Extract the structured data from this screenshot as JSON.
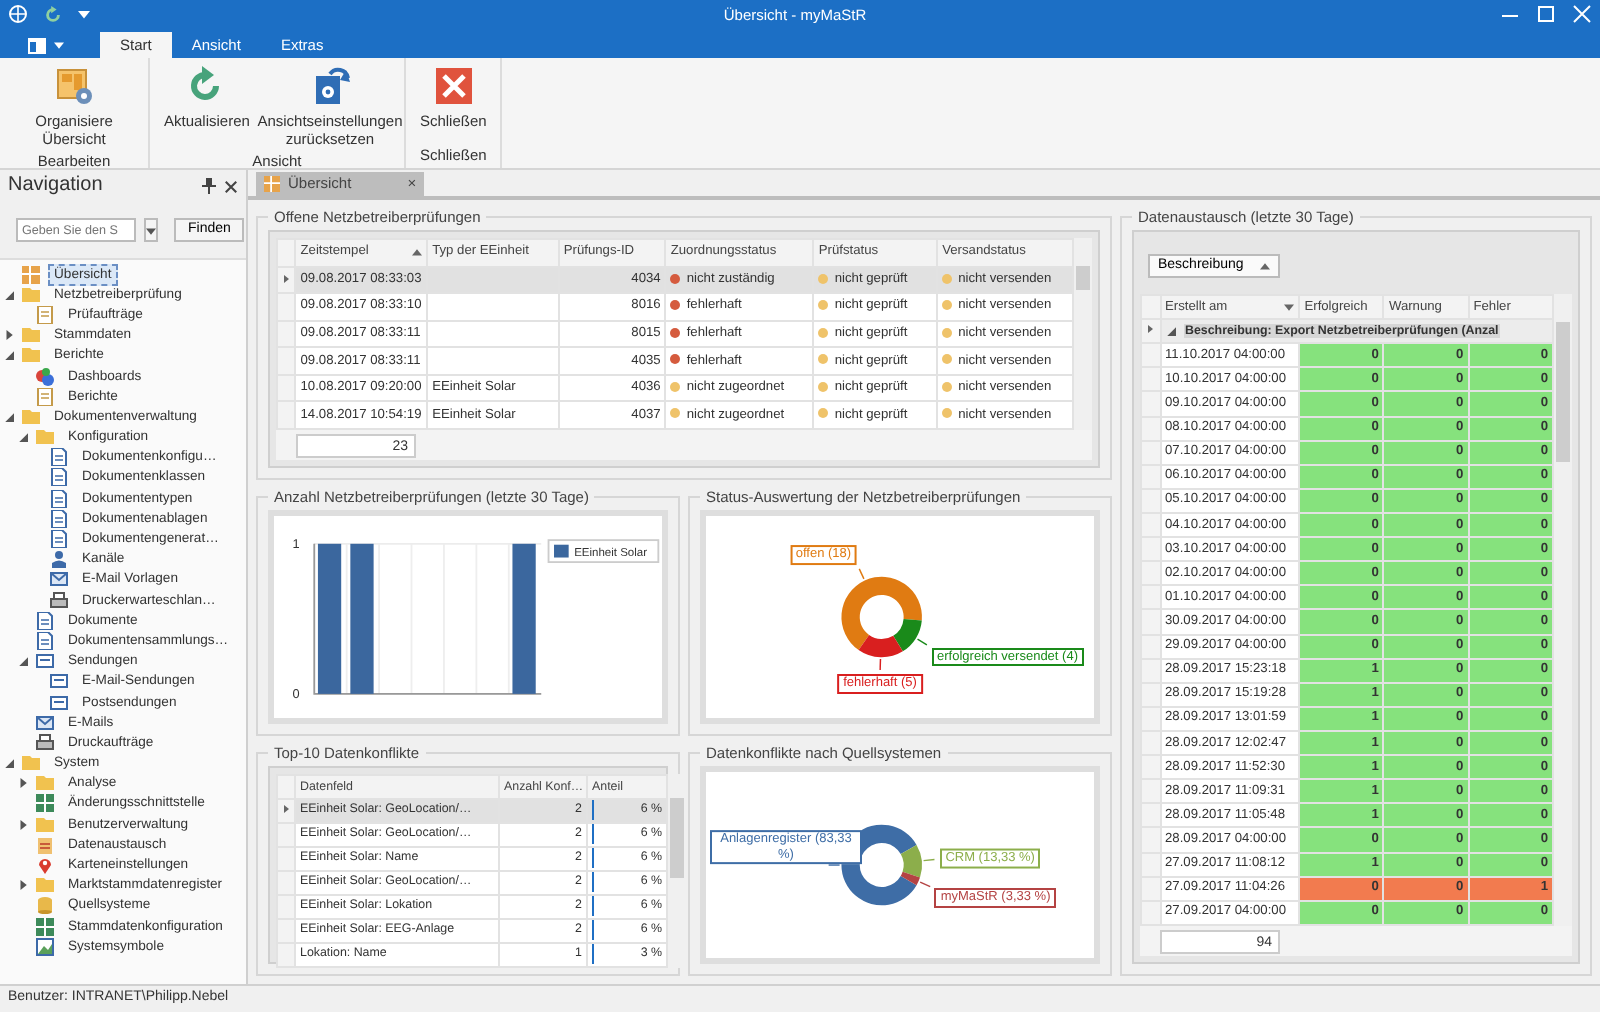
{
  "window": {
    "title": "Übersicht - myMaStR"
  },
  "ribbon": {
    "tabs": [
      {
        "label": "Start",
        "selected": true
      },
      {
        "label": "Ansicht",
        "selected": false
      },
      {
        "label": "Extras",
        "selected": false
      }
    ],
    "groups": [
      {
        "label": "Bearbeiten",
        "buttons": [
          {
            "label": "Organisiere Übersicht",
            "kind": "organize"
          }
        ]
      },
      {
        "label": "Ansicht",
        "buttons": [
          {
            "label": "Aktualisieren",
            "kind": "refresh"
          },
          {
            "label": "Ansichtseinstellungen zurücksetzen",
            "kind": "reset"
          }
        ]
      },
      {
        "label": "Schließen",
        "buttons": [
          {
            "label": "Schließen",
            "kind": "close"
          }
        ]
      }
    ]
  },
  "navigation": {
    "title": "Navigation",
    "search": {
      "placeholder": "Geben Sie den S"
    },
    "find_button": "Finden",
    "tree": [
      {
        "label": "Übersicht",
        "kind": "overview",
        "selected": true
      },
      {
        "label": "Netzbetreiberprüfung",
        "kind": "folder",
        "selected": false,
        "expanded": true,
        "children": [
          {
            "label": "Prüfaufträge",
            "kind": "page",
            "selected": false
          }
        ]
      },
      {
        "label": "Stammdaten",
        "kind": "folder",
        "selected": false,
        "expanded": false
      },
      {
        "label": "Berichte",
        "kind": "folder",
        "selected": false,
        "expanded": true,
        "children": [
          {
            "label": "Dashboards",
            "kind": "dashboard",
            "selected": false
          },
          {
            "label": "Berichte",
            "kind": "page",
            "selected": false
          }
        ]
      },
      {
        "label": "Dokumentenverwaltung",
        "kind": "folder",
        "selected": false,
        "expanded": true,
        "children": [
          {
            "label": "Konfiguration",
            "kind": "folder",
            "selected": false,
            "expanded": true,
            "children": [
              {
                "label": "Dokumentenkonfigu…",
                "kind": "doc",
                "selected": false
              },
              {
                "label": "Dokumentenklassen",
                "kind": "doc",
                "selected": false
              },
              {
                "label": "Dokumententypen",
                "kind": "doc",
                "selected": false
              },
              {
                "label": "Dokumentenablagen",
                "kind": "doc",
                "selected": false
              },
              {
                "label": "Dokumentengenerat…",
                "kind": "doc",
                "selected": false
              },
              {
                "label": "Kanäle",
                "kind": "person",
                "selected": false
              },
              {
                "label": "E-Mail Vorlagen",
                "kind": "mail",
                "selected": false
              },
              {
                "label": "Druckerwarteschlan…",
                "kind": "printer",
                "selected": false
              }
            ]
          },
          {
            "label": "Dokumente",
            "kind": "doc",
            "selected": false
          },
          {
            "label": "Dokumentensammlungs…",
            "kind": "doc",
            "selected": false
          },
          {
            "label": "Sendungen",
            "kind": "envelope",
            "selected": false,
            "expanded": true,
            "children": [
              {
                "label": "E-Mail-Sendungen",
                "kind": "envelope",
                "selected": false
              },
              {
                "label": "Postsendungen",
                "kind": "envelope",
                "selected": false
              }
            ]
          },
          {
            "label": "E-Mails",
            "kind": "mail",
            "selected": false
          },
          {
            "label": "Druckaufträge",
            "kind": "printer",
            "selected": false
          }
        ]
      },
      {
        "label": "System",
        "kind": "folder",
        "selected": false,
        "expanded": true,
        "children": [
          {
            "label": "Analyse",
            "kind": "folder",
            "selected": false,
            "expanded": false
          },
          {
            "label": "Änderungsschnittstelle",
            "kind": "grid",
            "selected": false
          },
          {
            "label": "Benutzerverwaltung",
            "kind": "folder",
            "selected": false,
            "expanded": false
          },
          {
            "label": "Datenaustausch",
            "kind": "exchange",
            "selected": false
          },
          {
            "label": "Karteneinstellungen",
            "kind": "marker",
            "selected": false
          },
          {
            "label": "Marktstammdatenregister",
            "kind": "folder",
            "selected": false,
            "expanded": false
          },
          {
            "label": "Quellsysteme",
            "kind": "database",
            "selected": false
          },
          {
            "label": "Stammdatenkonfiguration",
            "kind": "grid",
            "selected": false
          },
          {
            "label": "Systemsymbole",
            "kind": "image",
            "selected": false
          }
        ]
      }
    ]
  },
  "document_tab": {
    "label": "Übersicht",
    "close": "×",
    "selected": true
  },
  "open_checks": {
    "title": "Offene Netzbetreiberprüfungen",
    "columns": [
      {
        "label": "Zeitstempel",
        "sorted_ascending": true
      },
      {
        "label": "Typ der EEinheit"
      },
      {
        "label": "Prüfungs-ID"
      },
      {
        "label": "Zuordnungsstatus"
      },
      {
        "label": "Prüfstatus"
      },
      {
        "label": "Versandstatus"
      }
    ],
    "rows": [
      {
        "selected": true,
        "timestamp": "09.08.2017 08:33:03",
        "type": "",
        "id": "4034",
        "statuses": [
          {
            "text": "nicht zuständig",
            "color": "#d55b3e"
          },
          {
            "text": "nicht geprüft",
            "color": "#efc36a"
          },
          {
            "text": "nicht versenden",
            "color": "#efc36a"
          }
        ]
      },
      {
        "selected": false,
        "timestamp": "09.08.2017 08:33:10",
        "type": "",
        "id": "8016",
        "statuses": [
          {
            "text": "fehlerhaft",
            "color": "#d55b3e"
          },
          {
            "text": "nicht geprüft",
            "color": "#efc36a"
          },
          {
            "text": "nicht versenden",
            "color": "#efc36a"
          }
        ]
      },
      {
        "selected": false,
        "timestamp": "09.08.2017 08:33:11",
        "type": "",
        "id": "8015",
        "statuses": [
          {
            "text": "fehlerhaft",
            "color": "#d55b3e"
          },
          {
            "text": "nicht geprüft",
            "color": "#efc36a"
          },
          {
            "text": "nicht versenden",
            "color": "#efc36a"
          }
        ]
      },
      {
        "selected": false,
        "timestamp": "09.08.2017 08:33:11",
        "type": "",
        "id": "4035",
        "statuses": [
          {
            "text": "fehlerhaft",
            "color": "#d55b3e"
          },
          {
            "text": "nicht geprüft",
            "color": "#efc36a"
          },
          {
            "text": "nicht versenden",
            "color": "#efc36a"
          }
        ]
      },
      {
        "selected": false,
        "timestamp": "10.08.2017 09:20:00",
        "type": "EEinheit Solar",
        "id": "4036",
        "statuses": [
          {
            "text": "nicht zugeordnet",
            "color": "#efc36a"
          },
          {
            "text": "nicht geprüft",
            "color": "#efc36a"
          },
          {
            "text": "nicht versenden",
            "color": "#efc36a"
          }
        ]
      },
      {
        "selected": false,
        "timestamp": "14.08.2017 10:54:19",
        "type": "EEinheit Solar",
        "id": "4037",
        "statuses": [
          {
            "text": "nicht zugeordnet",
            "color": "#efc36a"
          },
          {
            "text": "nicht geprüft",
            "color": "#efc36a"
          },
          {
            "text": "nicht versenden",
            "color": "#efc36a"
          }
        ]
      }
    ],
    "count": "23"
  },
  "checks_chart": {
    "title": "Anzahl Netzbetreiberprüfungen (letzte 30 Tage)",
    "chart_data": {
      "type": "bar",
      "yticks": [
        0,
        1
      ],
      "ylim": [
        0,
        1
      ],
      "series": [
        {
          "name": "EEinheit Solar",
          "color": "#3b679e",
          "values": [
            1,
            1,
            0,
            0,
            0,
            0,
            1
          ]
        }
      ]
    }
  },
  "status_chart": {
    "title": "Status-Auswertung der Netzbetreiberprüfungen",
    "chart_data": {
      "type": "donut",
      "values": [
        18,
        4,
        5
      ],
      "colors": [
        "#e07b12",
        "#1a8a1a",
        "#d91f1f"
      ],
      "value_labels": [
        "offen (18)",
        "erfolgreich versendet (4)",
        "fehlerhaft (5)"
      ]
    }
  },
  "conflicts": {
    "title": "Top-10 Datenkonflikte",
    "columns": [
      "Datenfeld",
      "Anzahl Konf…",
      "Anteil"
    ],
    "rows": [
      {
        "field": "EEinheit Solar: GeoLocation/…",
        "count": "2",
        "share": "6 %",
        "level": 0.06,
        "selected": true
      },
      {
        "field": "EEinheit Solar: GeoLocation/…",
        "count": "2",
        "share": "6 %",
        "level": 0.06,
        "selected": false
      },
      {
        "field": "EEinheit Solar: Name",
        "count": "2",
        "share": "6 %",
        "level": 0.06,
        "selected": false
      },
      {
        "field": "EEinheit Solar: GeoLocation/…",
        "count": "2",
        "share": "6 %",
        "level": 0.06,
        "selected": false
      },
      {
        "field": "EEinheit Solar: Lokation",
        "count": "2",
        "share": "6 %",
        "level": 0.06,
        "selected": false
      },
      {
        "field": "EEinheit Solar: EEG-Anlage",
        "count": "2",
        "share": "6 %",
        "level": 0.06,
        "selected": false
      },
      {
        "field": "Lokation: Name",
        "count": "1",
        "share": "3 %",
        "level": 0.03,
        "selected": false
      }
    ]
  },
  "sources_chart": {
    "title": "Datenkonflikte nach Quellsystemen",
    "chart_data": {
      "type": "donut",
      "values": [
        83.33,
        13.33,
        3.33
      ],
      "colors": [
        "#3e6da6",
        "#8cae4b",
        "#b44343"
      ],
      "value_labels": [
        "Anlagenregister (83,33 %)",
        "CRM (13,33 %)",
        "myMaStR (3,33 %)"
      ]
    }
  },
  "data_exchange": {
    "title": "Datenaustausch (letzte 30 Tage)",
    "group_button": {
      "label": "Beschreibung",
      "sorted_ascending": true
    },
    "columns": [
      {
        "label": "Erstellt am",
        "sorted_descending": true
      },
      {
        "label": "Erfolgreich"
      },
      {
        "label": "Warnung"
      },
      {
        "label": "Fehler"
      }
    ],
    "group_row": {
      "text": "Beschreibung: Export Netzbetreiberprüfungen (Anzal",
      "expanded": true,
      "selected": true
    },
    "rows": [
      {
        "cells": [
          "11.10.2017 04:00:00",
          "0",
          "0",
          "0"
        ],
        "color": "#86e27d"
      },
      {
        "cells": [
          "10.10.2017 04:00:00",
          "0",
          "0",
          "0"
        ],
        "color": "#86e27d"
      },
      {
        "cells": [
          "09.10.2017 04:00:00",
          "0",
          "0",
          "0"
        ],
        "color": "#86e27d"
      },
      {
        "cells": [
          "08.10.2017 04:00:00",
          "0",
          "0",
          "0"
        ],
        "color": "#86e27d"
      },
      {
        "cells": [
          "07.10.2017 04:00:00",
          "0",
          "0",
          "0"
        ],
        "color": "#86e27d"
      },
      {
        "cells": [
          "06.10.2017 04:00:00",
          "0",
          "0",
          "0"
        ],
        "color": "#86e27d"
      },
      {
        "cells": [
          "05.10.2017 04:00:00",
          "0",
          "0",
          "0"
        ],
        "color": "#86e27d"
      },
      {
        "cells": [
          "04.10.2017 04:00:00",
          "0",
          "0",
          "0"
        ],
        "color": "#86e27d"
      },
      {
        "cells": [
          "03.10.2017 04:00:00",
          "0",
          "0",
          "0"
        ],
        "color": "#86e27d"
      },
      {
        "cells": [
          "02.10.2017 04:00:00",
          "0",
          "0",
          "0"
        ],
        "color": "#86e27d"
      },
      {
        "cells": [
          "01.10.2017 04:00:00",
          "0",
          "0",
          "0"
        ],
        "color": "#86e27d"
      },
      {
        "cells": [
          "30.09.2017 04:00:00",
          "0",
          "0",
          "0"
        ],
        "color": "#86e27d"
      },
      {
        "cells": [
          "29.09.2017 04:00:00",
          "0",
          "0",
          "0"
        ],
        "color": "#86e27d"
      },
      {
        "cells": [
          "28.09.2017 15:23:18",
          "1",
          "0",
          "0"
        ],
        "color": "#86e27d"
      },
      {
        "cells": [
          "28.09.2017 15:19:28",
          "1",
          "0",
          "0"
        ],
        "color": "#86e27d"
      },
      {
        "cells": [
          "28.09.2017 13:01:59",
          "1",
          "0",
          "0"
        ],
        "color": "#86e27d"
      },
      {
        "cells": [
          "28.09.2017 12:02:47",
          "1",
          "0",
          "0"
        ],
        "color": "#86e27d"
      },
      {
        "cells": [
          "28.09.2017 11:52:30",
          "1",
          "0",
          "0"
        ],
        "color": "#86e27d"
      },
      {
        "cells": [
          "28.09.2017 11:09:31",
          "1",
          "0",
          "0"
        ],
        "color": "#86e27d"
      },
      {
        "cells": [
          "28.09.2017 11:05:48",
          "1",
          "0",
          "0"
        ],
        "color": "#86e27d"
      },
      {
        "cells": [
          "28.09.2017 04:00:00",
          "0",
          "0",
          "0"
        ],
        "color": "#86e27d"
      },
      {
        "cells": [
          "27.09.2017 11:08:12",
          "1",
          "0",
          "0"
        ],
        "color": "#86e27d"
      },
      {
        "cells": [
          "27.09.2017 11:04:26",
          "0",
          "0",
          "1"
        ],
        "color": "#f27b4f"
      },
      {
        "cells": [
          "27.09.2017 04:00:00",
          "0",
          "0",
          "0"
        ],
        "color": "#86e27d"
      }
    ],
    "count": "94"
  },
  "status_bar": {
    "text": "Benutzer: INTRANET\\Philipp.Nebel"
  }
}
